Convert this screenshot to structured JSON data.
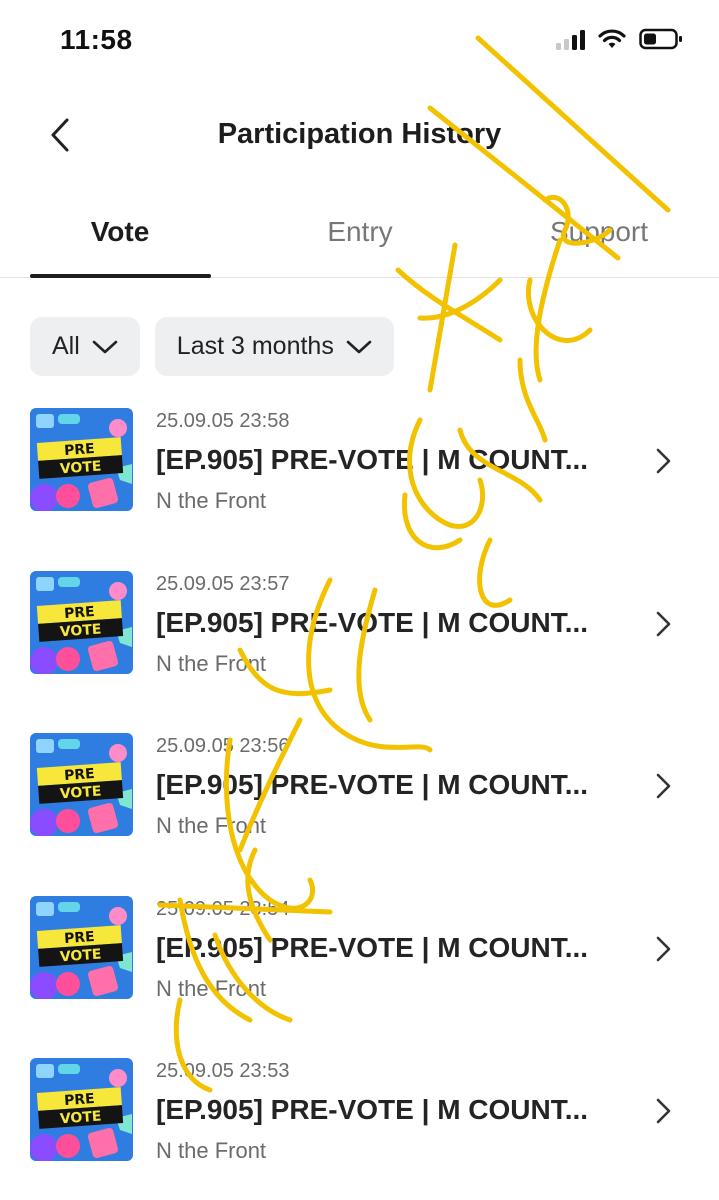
{
  "status_bar": {
    "time": "11:58",
    "icons": [
      "signal-icon",
      "wifi-icon",
      "battery-icon"
    ]
  },
  "header": {
    "back_icon": "chevron-left-icon",
    "title": "Participation History"
  },
  "tabs": [
    {
      "label": "Vote",
      "active": true
    },
    {
      "label": "Entry",
      "active": false
    },
    {
      "label": "Support",
      "active": false
    }
  ],
  "filters": [
    {
      "label": "All",
      "icon": "chevron-down-icon"
    },
    {
      "label": "Last 3 months",
      "icon": "chevron-down-icon"
    }
  ],
  "items": [
    {
      "date": "25.09.05 23:58",
      "title": "[EP.905] PRE-VOTE | M COUNT...",
      "subtitle": "N the Front",
      "thumb_line1": "PRE",
      "thumb_line2": "VOTE"
    },
    {
      "date": "25.09.05 23:57",
      "title": "[EP.905] PRE-VOTE | M COUNT...",
      "subtitle": "N the Front",
      "thumb_line1": "PRE",
      "thumb_line2": "VOTE"
    },
    {
      "date": "25.09.05 23:56",
      "title": "[EP.905] PRE-VOTE | M COUNT...",
      "subtitle": "N the Front",
      "thumb_line1": "PRE",
      "thumb_line2": "VOTE"
    },
    {
      "date": "25.09.05 23:54",
      "title": "[EP.905] PRE-VOTE | M COUNT...",
      "subtitle": "N the Front",
      "thumb_line1": "PRE",
      "thumb_line2": "VOTE"
    },
    {
      "date": "25.09.05 23:53",
      "title": "[EP.905] PRE-VOTE | M COUNT...",
      "subtitle": "N the Front",
      "thumb_line1": "PRE",
      "thumb_line2": "VOTE"
    }
  ],
  "colors": {
    "scribble": "#f2c200",
    "active_tab": "#1d1d1d",
    "inactive_tab": "#777777",
    "chip_bg": "#eeeff1"
  }
}
